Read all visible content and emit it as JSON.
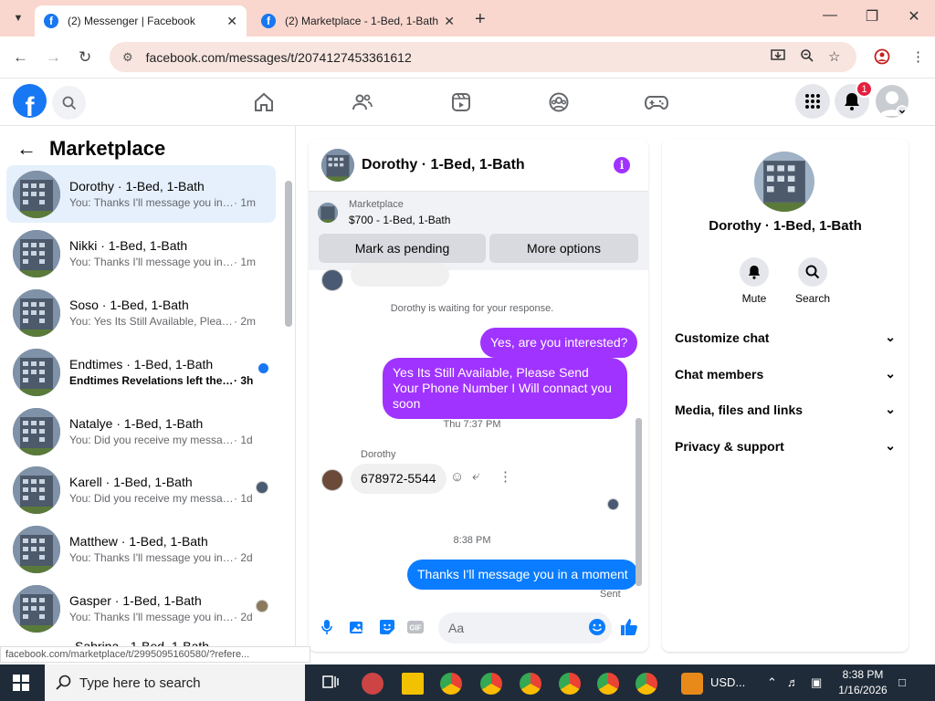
{
  "browser": {
    "tabs": [
      {
        "title": "(2) Messenger | Facebook",
        "active": true
      },
      {
        "title": "(2) Marketplace - 1-Bed, 1-Bath",
        "active": false
      }
    ],
    "url": "facebook.com/messages/t/2074127453361612",
    "status_url": "facebook.com/marketplace/t/2995095160580/?refere..."
  },
  "notifications_count": "1",
  "left": {
    "title": "Marketplace",
    "conversations": [
      {
        "name": "Dorothy · 1-Bed, 1-Bath",
        "preview": "You: Thanks I'll message you in a ...",
        "time": " · 1m",
        "selected": true
      },
      {
        "name": "Nikki · 1-Bed, 1-Bath",
        "preview": "You: Thanks I'll message you in a ...",
        "time": " · 1m"
      },
      {
        "name": "Soso · 1-Bed, 1-Bath",
        "preview": "You: Yes Its Still Available, Please S...",
        "time": " · 2m"
      },
      {
        "name": "Endtimes · 1-Bed, 1-Bath",
        "preview": "Endtimes Revelations left the gr...",
        "time": " · 3h",
        "unread": true
      },
      {
        "name": "Natalye · 1-Bed, 1-Bath",
        "preview": "You: Did you receive my message",
        "time": " · 1d"
      },
      {
        "name": "Karell · 1-Bed, 1-Bath",
        "preview": "You: Did you receive my message",
        "time": " · 1d"
      },
      {
        "name": "Matthew · 1-Bed, 1-Bath",
        "preview": "You: Thanks I'll message you in a ...",
        "time": " · 2d"
      },
      {
        "name": "Gasper · 1-Bed, 1-Bath",
        "preview": "You: Thanks I'll message you in ...",
        "time": " · 2d"
      },
      {
        "name": "Sabrina · 1-Bed, 1-Bath",
        "preview": "",
        "time": ""
      }
    ]
  },
  "chat": {
    "title": "Dorothy · 1-Bed, 1-Bath",
    "marketplace_label": "Marketplace",
    "listing": "$700 - 1-Bed, 1-Bath",
    "mark_pending": "Mark as pending",
    "more_options": "More options",
    "waiting": "Dorothy is waiting for your response.",
    "msg_interested": "Yes, are you interested?",
    "msg_available": "Yes Its Still Available, Please Send Your Phone Number I Will connact you soon",
    "time1": "Thu 7:37 PM",
    "sender": "Dorothy",
    "msg_phone": "678972-5544",
    "time2": "8:38 PM",
    "msg_thanks": "Thanks I'll message you in a moment",
    "sent": "Sent",
    "input_placeholder": "Aa"
  },
  "right": {
    "name": "Dorothy · 1-Bed, 1-Bath",
    "mute": "Mute",
    "search": "Search",
    "sections": [
      "Customize chat",
      "Chat members",
      "Media, files and links",
      "Privacy & support"
    ]
  },
  "taskbar": {
    "search_placeholder": "Type here to search",
    "currency": "USD...",
    "time": "8:38 PM",
    "date": "1/16/2026"
  }
}
